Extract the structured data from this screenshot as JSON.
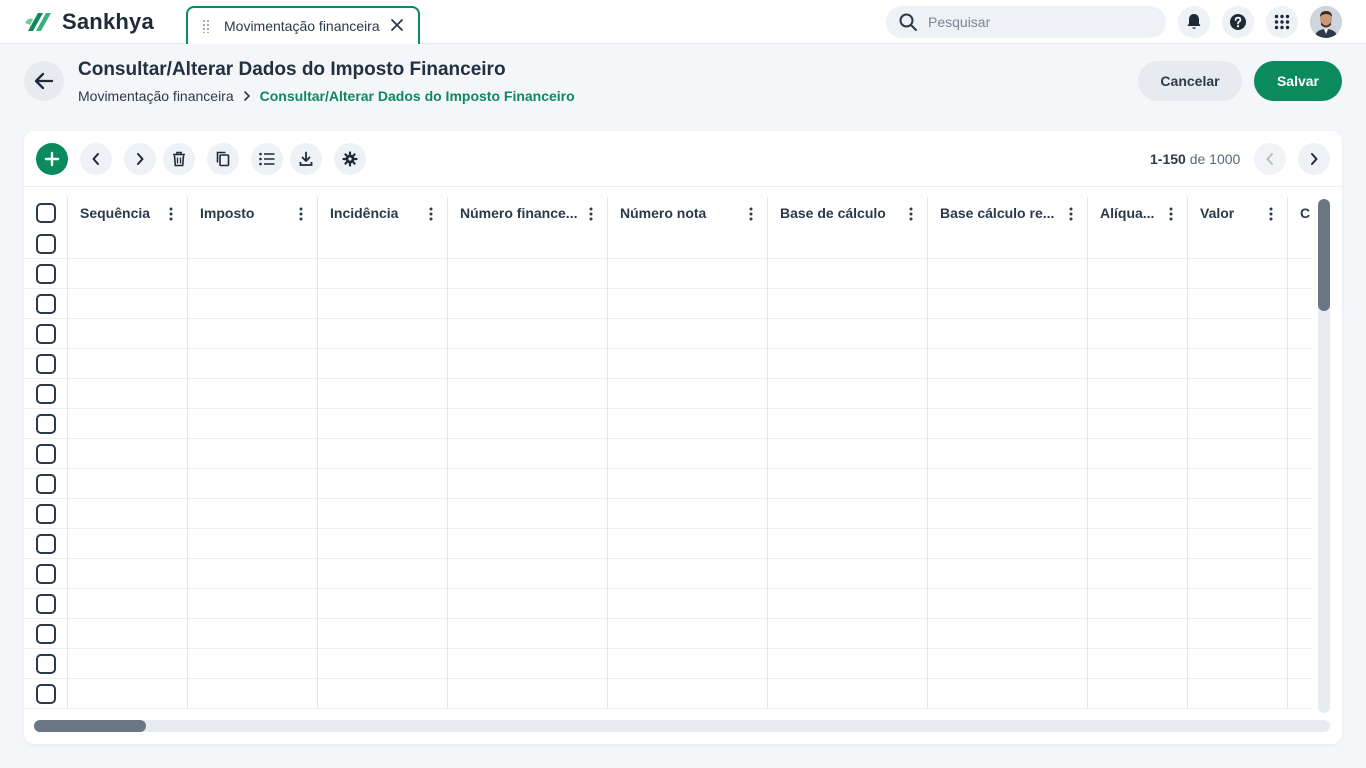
{
  "app": {
    "brand": "Sankhya",
    "brand_color": "#0b8a5e"
  },
  "tab": {
    "label": "Movimentação financeira"
  },
  "search": {
    "placeholder": "Pesquisar"
  },
  "header": {
    "title": "Consultar/Alterar Dados do Imposto Financeiro",
    "breadcrumb": [
      "Movimentação financeira",
      "Consultar/Alterar Dados do Imposto Financeiro"
    ],
    "cancel_label": "Cancelar",
    "save_label": "Salvar"
  },
  "toolbar": {
    "icons": [
      "plus-icon",
      "chevron-left-icon",
      "chevron-right-icon",
      "trash-icon",
      "copy-icon",
      "list-icon",
      "download-icon",
      "settings-icon"
    ]
  },
  "pager": {
    "range": "1-150",
    "of": "de",
    "total": "1000"
  },
  "grid": {
    "columns": [
      "Sequência",
      "Imposto",
      "Incidência",
      "Número finance...",
      "Número nota",
      "Base de cálculo",
      "Base cálculo re...",
      "Alíqua...",
      "Valor",
      "C"
    ],
    "row_count": 16
  }
}
